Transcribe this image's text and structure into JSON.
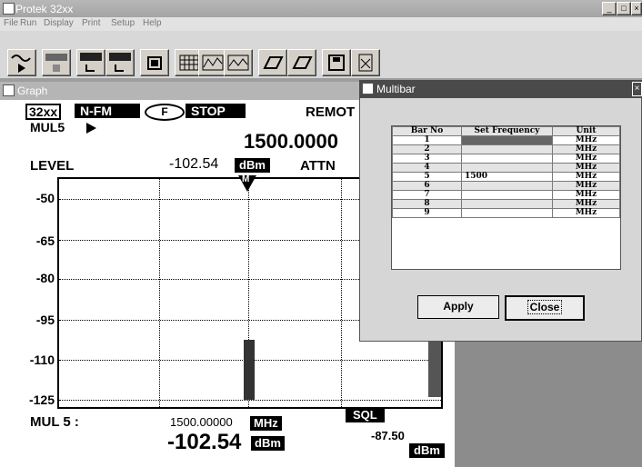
{
  "window": {
    "title": "Protek 32xx"
  },
  "menu": [
    "File",
    "Run",
    "Display",
    "Print",
    "Setup",
    "Help"
  ],
  "toolbar": {
    "icons": [
      "waveform-play-icon",
      "stop-icon",
      "freq-up-icon",
      "freq-down-icon",
      "display-icon",
      "grid-icon",
      "graph-icon",
      "graph2-icon",
      "print-icon",
      "print2-icon",
      "save-icon",
      "chart-icon"
    ]
  },
  "graph": {
    "title": "Graph",
    "model": "32xx",
    "mode": "N-FM",
    "f_badge": "F",
    "run_state": "STOP",
    "remote": "REMOT",
    "mul": "MUL5",
    "frequency": "1500.0000",
    "level_label": "LEVEL",
    "level_value": "-102.54",
    "level_unit": "dBm",
    "attn_label": "ATTN",
    "marker": "M",
    "y_ticks": [
      "-50",
      "-65",
      "-80",
      "-95",
      "-110",
      "-125"
    ],
    "bottom": {
      "mul_label": "MUL 5 :",
      "freq": "1500.00000",
      "freq_unit": "MHz",
      "level": "-102.54",
      "level_unit": "dBm",
      "sql_label": "SQL",
      "sql_value": "-87.50",
      "sql_unit": "dBm"
    },
    "bar_level_dbm": -102.54
  },
  "multibar": {
    "title": "Multibar",
    "headers": [
      "Bar No",
      "Set Frequency",
      "Unit"
    ],
    "rows": [
      {
        "no": "1",
        "freq": "",
        "unit": "MHz"
      },
      {
        "no": "2",
        "freq": "",
        "unit": "MHz"
      },
      {
        "no": "3",
        "freq": "",
        "unit": "MHz"
      },
      {
        "no": "4",
        "freq": "",
        "unit": "MHz"
      },
      {
        "no": "5",
        "freq": "1500",
        "unit": "MHz"
      },
      {
        "no": "6",
        "freq": "",
        "unit": "MHz"
      },
      {
        "no": "7",
        "freq": "",
        "unit": "MHz"
      },
      {
        "no": "8",
        "freq": "",
        "unit": "MHz"
      },
      {
        "no": "9",
        "freq": "",
        "unit": "MHz"
      }
    ],
    "apply_label": "Apply",
    "close_label": "Close"
  }
}
